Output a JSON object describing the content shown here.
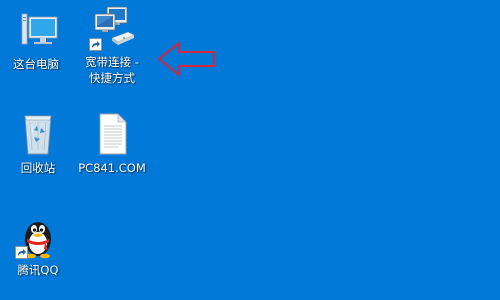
{
  "desktop": {
    "background_color": "#0179d8",
    "icons": [
      {
        "id": "this-pc",
        "label": "这台电脑",
        "icon": "computer-icon"
      },
      {
        "id": "broadband",
        "label_line1": "宽带连接 -",
        "label_line2": "快捷方式",
        "icon": "network-connection-icon",
        "shortcut": true
      },
      {
        "id": "recycle-bin",
        "label": "回收站",
        "icon": "recycle-bin-icon"
      },
      {
        "id": "text-file",
        "label": "PC841.COM",
        "icon": "text-file-icon"
      },
      {
        "id": "qq",
        "label": "腾讯QQ",
        "icon": "qq-penguin-icon",
        "shortcut": true
      }
    ]
  },
  "annotation": {
    "arrow_color": "#d0283a",
    "icon": "outline-left-arrow-icon"
  }
}
